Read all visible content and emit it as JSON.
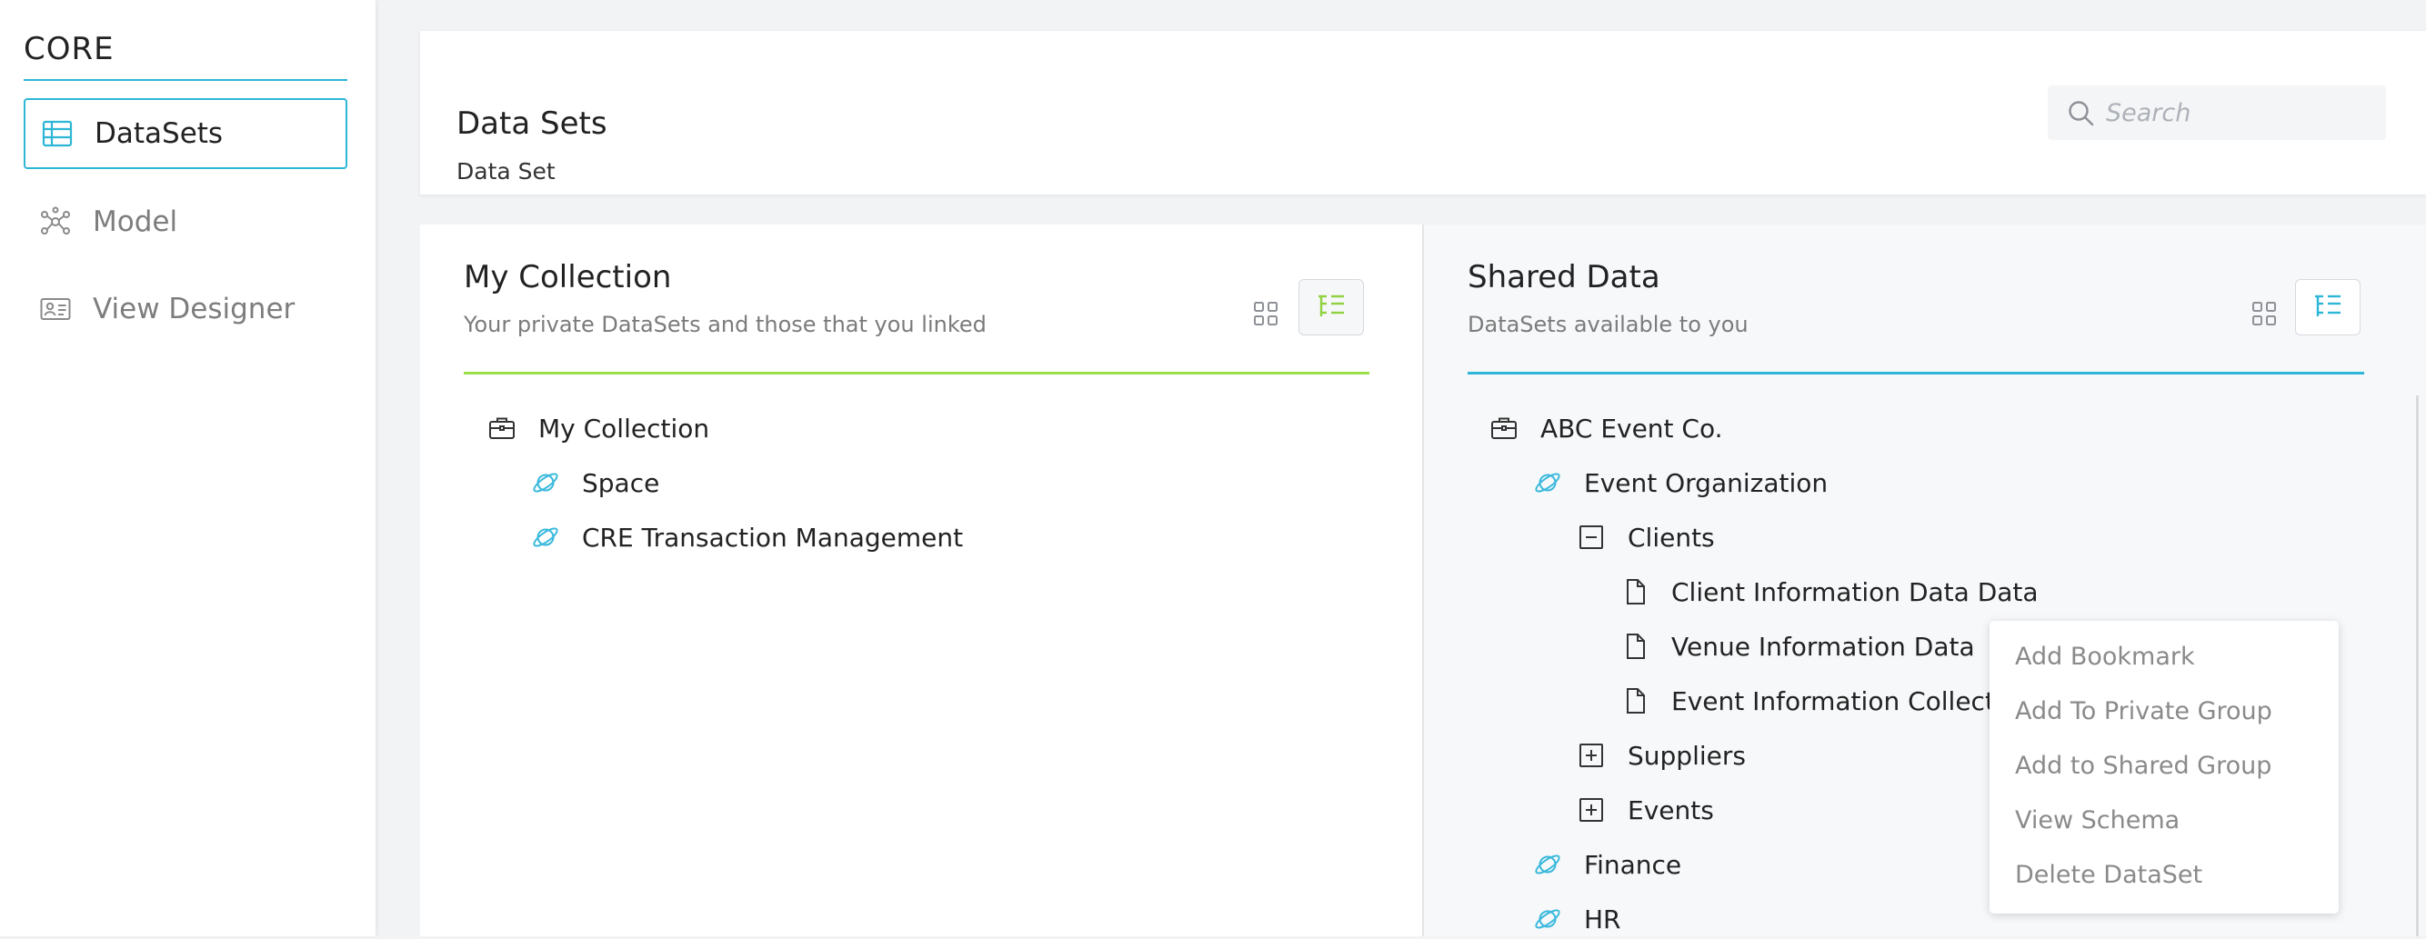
{
  "sidebar": {
    "brand": "CORE",
    "items": [
      {
        "label": "DataSets",
        "icon": "table-icon",
        "active": true
      },
      {
        "label": "Model",
        "icon": "network-icon",
        "active": false
      },
      {
        "label": "View Designer",
        "icon": "id-card-icon",
        "active": false
      }
    ]
  },
  "header": {
    "title": "Data Sets",
    "subtitle": "Data Set",
    "search_placeholder": "Search"
  },
  "my_collection": {
    "title": "My Collection",
    "subtitle": "Your private DataSets and those that you linked",
    "accent": "#9be04a",
    "tree": {
      "root": "My Collection",
      "children": [
        "Space",
        "CRE Transaction Management"
      ]
    }
  },
  "shared_data": {
    "title": "Shared Data",
    "subtitle": "DataSets available to you",
    "accent": "#2eb6d6",
    "tree": {
      "root": "ABC Event Co.",
      "group": "Event Organization",
      "clients": "Clients",
      "datasets": [
        "Client Information Data Data",
        "Venue Information Data",
        "Event Information Collection"
      ],
      "suppliers": "Suppliers",
      "events": "Events",
      "finance": "Finance",
      "hr": "HR"
    }
  },
  "context_menu": {
    "items": [
      "Add Bookmark",
      "Add To Private Group",
      "Add to Shared Group",
      "View Schema",
      "Delete DataSet"
    ]
  }
}
